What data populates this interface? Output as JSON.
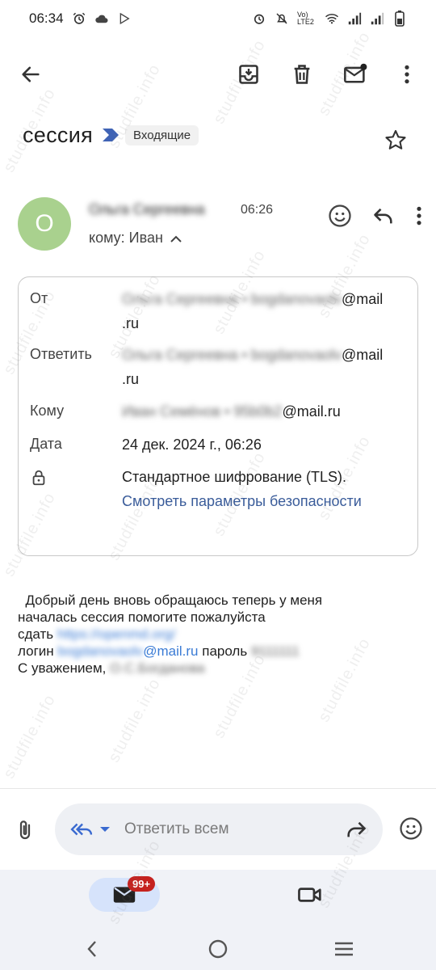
{
  "status_bar": {
    "time": "06:34",
    "network": "Vo) LTE2"
  },
  "toolbar": {
    "back_icon": "arrow-left",
    "archive_icon": "archive",
    "delete_icon": "trash",
    "mark_unread_icon": "mail-dot",
    "more_icon": "more-vertical"
  },
  "email": {
    "subject": "сессия",
    "label": "Входящие",
    "sender": {
      "avatar_letter": "О",
      "avatar_color": "#a9d18e",
      "name": "Ольга Сергеевна",
      "time": "06:26",
      "to_line": "кому: Иван"
    },
    "details": {
      "from_label": "От",
      "from_value_blurred": "Ольга Сергеевна • bogdanovaolv",
      "from_value_suffix": "@mail",
      "from_value_tail": ".ru",
      "reply_label": "Ответить",
      "reply_value_blurred": "Ольга Сергеевна • bogdanovaolv",
      "reply_value_suffix": "@mail",
      "reply_value_tail": ".ru",
      "to_label": "Кому",
      "to_value_blurred": "Иван Семёнов • 95b0b2",
      "to_value_suffix": "@mail.ru",
      "date_label": "Дата",
      "date_value": "24 дек. 2024 г., 06:26",
      "encryption_text": "Стандартное шифрование (TLS).",
      "security_link": "Смотреть параметры безопасности"
    },
    "body": {
      "line1": "  Добрый день вновь обращаюсь теперь у меня",
      "line2": "началась сессия помогите пожалуйста",
      "line3_prefix": "сдать ",
      "line3_blurred": "https://openmd.org/",
      "line4_prefix": "логин ",
      "line4_blurred": "bogdanovaolv",
      "line4_mail": "@mail.ru",
      "line4_password_label": " пароль ",
      "line4_password_blurred": "9111111",
      "line5_prefix": "С уважением, ",
      "line5_blurred": "О.С.Богданова"
    }
  },
  "reply_bar": {
    "placeholder": "Ответить всем"
  },
  "bottom_nav": {
    "badge": "99+"
  },
  "watermark": "studfile.info"
}
